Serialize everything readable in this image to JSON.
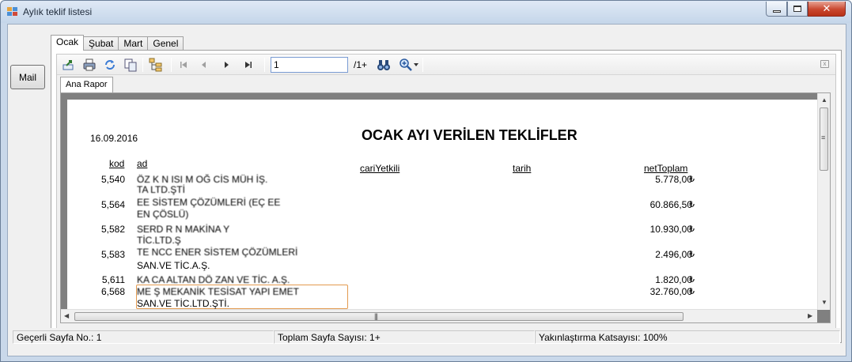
{
  "window": {
    "title": "Aylık teklif listesi",
    "close_glyph": "✕"
  },
  "left_panel": {
    "mail_button": "Mail"
  },
  "tabs": [
    {
      "label": "Ocak",
      "active": true
    },
    {
      "label": "Şubat",
      "active": false
    },
    {
      "label": "Mart",
      "active": false
    },
    {
      "label": "Genel",
      "active": false
    }
  ],
  "toolbar": {
    "icons": [
      "export-icon",
      "print-icon",
      "refresh-icon",
      "copy-icon",
      "group-tree-icon"
    ],
    "nav_first": "first-page-icon",
    "nav_prev": "previous-page-icon",
    "nav_next": "next-page-icon",
    "nav_last": "last-page-icon",
    "page_value": "1",
    "page_total": "/1+",
    "search_icon": "binoculars-icon",
    "zoom_icon": "zoom-icon"
  },
  "report_tab": "Ana Rapor",
  "report": {
    "date": "16.09.2016",
    "title": "OCAK AYI VERİLEN TEKLİFLER",
    "columns": {
      "kod": "kod",
      "ad": "ad",
      "cari": "cariYetkili",
      "tarih": "tarih",
      "net": "netToplam"
    },
    "currency_symbol": "₺",
    "rows": [
      {
        "kod": "5,540",
        "ad1": "ÖZ  K  N  ISI  M  OĞ  CİS  MÜH  İŞ.",
        "ad2": "TA  LTD.ŞTİ",
        "net": "5.778,00"
      },
      {
        "kod": "5,564",
        "ad1": "EE  SİSTEM  ÇÖZÜMLERİ (EÇ  EE",
        "ad2": "EN  ÇÖSLÜ)",
        "net": "60.866,50"
      },
      {
        "kod": "5,582",
        "ad1": "SERD  R  N  MAKİNA  Y",
        "ad2": "TİC.LTD.Ş",
        "net": "10.930,00"
      },
      {
        "kod": "5,583",
        "ad1": "TE  NCC  ENER  SİSTEM ÇÖZÜMLERİ",
        "ad2": "SAN.VE TİC.A.Ş.",
        "net": "2.496,00"
      },
      {
        "kod": "5,611",
        "ad1": "KA  CA  ALTAN  DÖ  ZAN  VE  TİC. A.Ş.",
        "ad2": "",
        "net": "1.820,00"
      },
      {
        "kod": "6,568",
        "ad1": "ME  Ş  MEKANİK  TESİSAT  YAPI  EMET",
        "ad2": "SAN.VE TİC.LTD.ŞTİ.",
        "net": "32.760,00"
      }
    ]
  },
  "status": {
    "current_page": "Geçerli Sayfa No.: 1",
    "total_pages": "Toplam Sayfa Sayısı: 1+",
    "zoom": "Yakınlaştırma Katsayısı: 100%"
  },
  "colors": {
    "accent": "#c9d8ea",
    "close": "#c9472f",
    "selection": "#e39a4f"
  }
}
